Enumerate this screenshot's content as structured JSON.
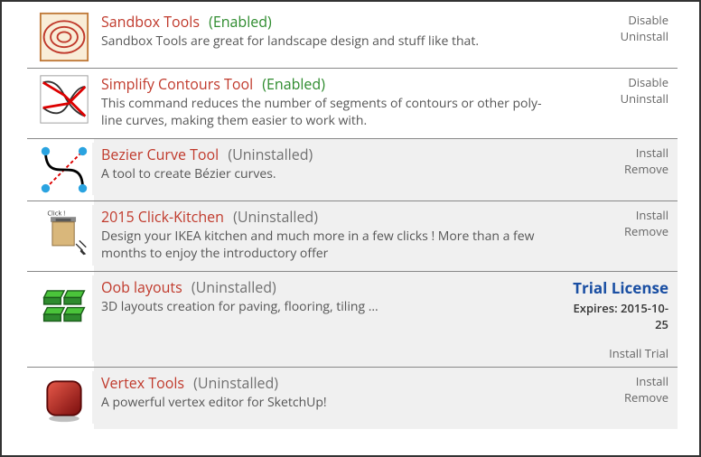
{
  "extensions": [
    {
      "icon": "sandbox",
      "title": "Sandbox Tools",
      "status_label": "(Enabled)",
      "status_kind": "enabled",
      "desc": "Sandbox Tools are great for landscape design and stuff like that.",
      "actions": [
        "Disable",
        "Uninstall"
      ],
      "shaded": false
    },
    {
      "icon": "simplify",
      "title": "Simplify Contours Tool",
      "status_label": "(Enabled)",
      "status_kind": "enabled",
      "desc": "This command reduces the number of segments of contours or other poly-line curves, making them easier to work with.",
      "actions": [
        "Disable",
        "Uninstall"
      ],
      "shaded": false
    },
    {
      "icon": "bezier",
      "title": "Bezier Curve Tool",
      "status_label": "(Uninstalled)",
      "status_kind": "uninstalled",
      "desc": "A tool to create Bézier curves.",
      "actions": [
        "Install",
        "Remove"
      ],
      "shaded": true
    },
    {
      "icon": "kitchen",
      "title": "2015 Click-Kitchen",
      "status_label": "(Uninstalled)",
      "status_kind": "uninstalled",
      "desc": "Design your IKEA kitchen and much more in a few clicks ! More than a few months to enjoy the introductory offer",
      "actions": [
        "Install",
        "Remove"
      ],
      "shaded": true
    },
    {
      "icon": "oob",
      "title": "Oob layouts",
      "status_label": "(Uninstalled)",
      "status_kind": "uninstalled",
      "desc": "3D layouts creation for paving, flooring, tiling ...",
      "trial": {
        "head": "Trial License",
        "expires": "Expires: 2015-10-25",
        "install": "Install Trial"
      },
      "shaded": true
    },
    {
      "icon": "vertex",
      "title": "Vertex Tools",
      "status_label": "(Uninstalled)",
      "status_kind": "uninstalled",
      "desc": "A powerful vertex editor for SketchUp!",
      "actions": [
        "Install",
        "Remove"
      ],
      "shaded": true
    }
  ]
}
